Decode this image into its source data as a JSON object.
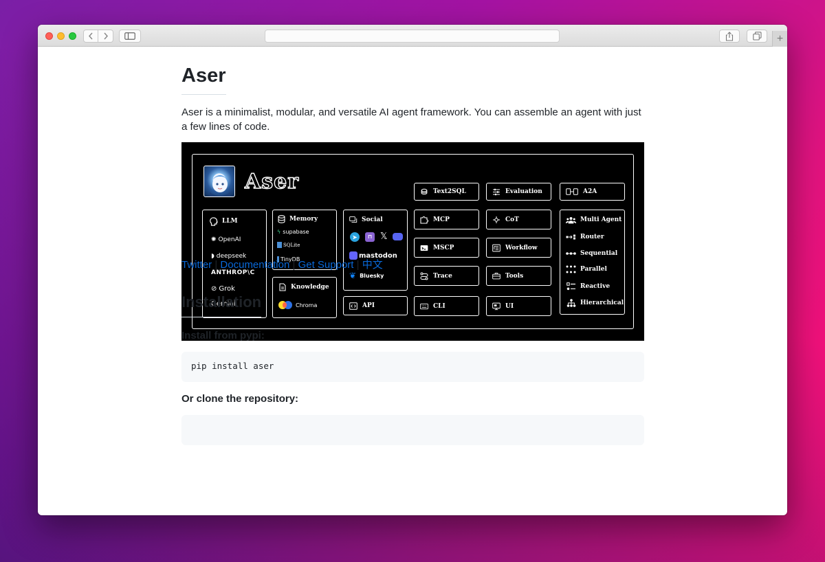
{
  "browser": {
    "url": "",
    "new_tab_glyph": "+"
  },
  "readme": {
    "title": "Aser",
    "intro": "Aser is a minimalist, modular, and versatile AI agent framework. You can assemble an agent with just a few lines of code.",
    "links": [
      "Twitter",
      "Documentation",
      "Get Support",
      "中文"
    ],
    "link_separator": " | ",
    "installation_heading": "Installation",
    "install_pypi_label": "Install from pypi:",
    "install_pypi_code": "pip install aser",
    "clone_label": "Or clone the repository:"
  },
  "banner": {
    "logo_text": "Aser",
    "llm": {
      "title": "LLM",
      "items": [
        "OpenAI",
        "deepseek",
        "ANTHROP\\C",
        "Grok",
        "Gemini"
      ]
    },
    "memory": {
      "title": "Memory",
      "items": [
        "supabase",
        "SQLite",
        "TinyDB"
      ]
    },
    "knowledge": {
      "title": "Knowledge",
      "items": [
        "Chroma"
      ]
    },
    "social": {
      "title": "Social",
      "items": [
        "mastodon",
        "Bluesky"
      ]
    },
    "api": "API",
    "text2sql": "Text2SQL",
    "mcp": "MCP",
    "mscp": "MSCP",
    "trace": "Trace",
    "cli": "CLI",
    "evaluation": "Evaluation",
    "cot": "CoT",
    "workflow": "Workflow",
    "tools": "Tools",
    "ui": "UI",
    "a2a": "A2A",
    "multi_agent": {
      "title": "Multi Agent",
      "items": [
        "Router",
        "Sequential",
        "Parallel",
        "Reactive",
        "Hierarchical"
      ]
    }
  },
  "colors": {
    "link": "#0969da",
    "text": "#1f2328",
    "code_bg": "#f6f8fa",
    "banner_bg": "#000000"
  }
}
